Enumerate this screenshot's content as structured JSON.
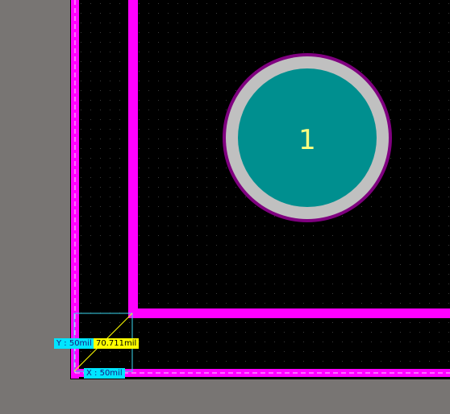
{
  "colors": {
    "background_gray": "#787573",
    "board_black": "#000000",
    "outline_magenta": "#ff00ff",
    "pad_copper": "#008f8f",
    "pad_ring": "#c0c0c0",
    "pad_mask": "#800080",
    "pad_label": "#ffff80",
    "grid_dot": "#3c3c3c",
    "measure_cyan": "#3ad8f0",
    "measure_yellow": "#ffff00"
  },
  "pad": {
    "designator": "1"
  },
  "measurement": {
    "y_label": "Y : 50mil",
    "x_label": "X : 50mil",
    "diagonal_label": "70.711mil"
  }
}
